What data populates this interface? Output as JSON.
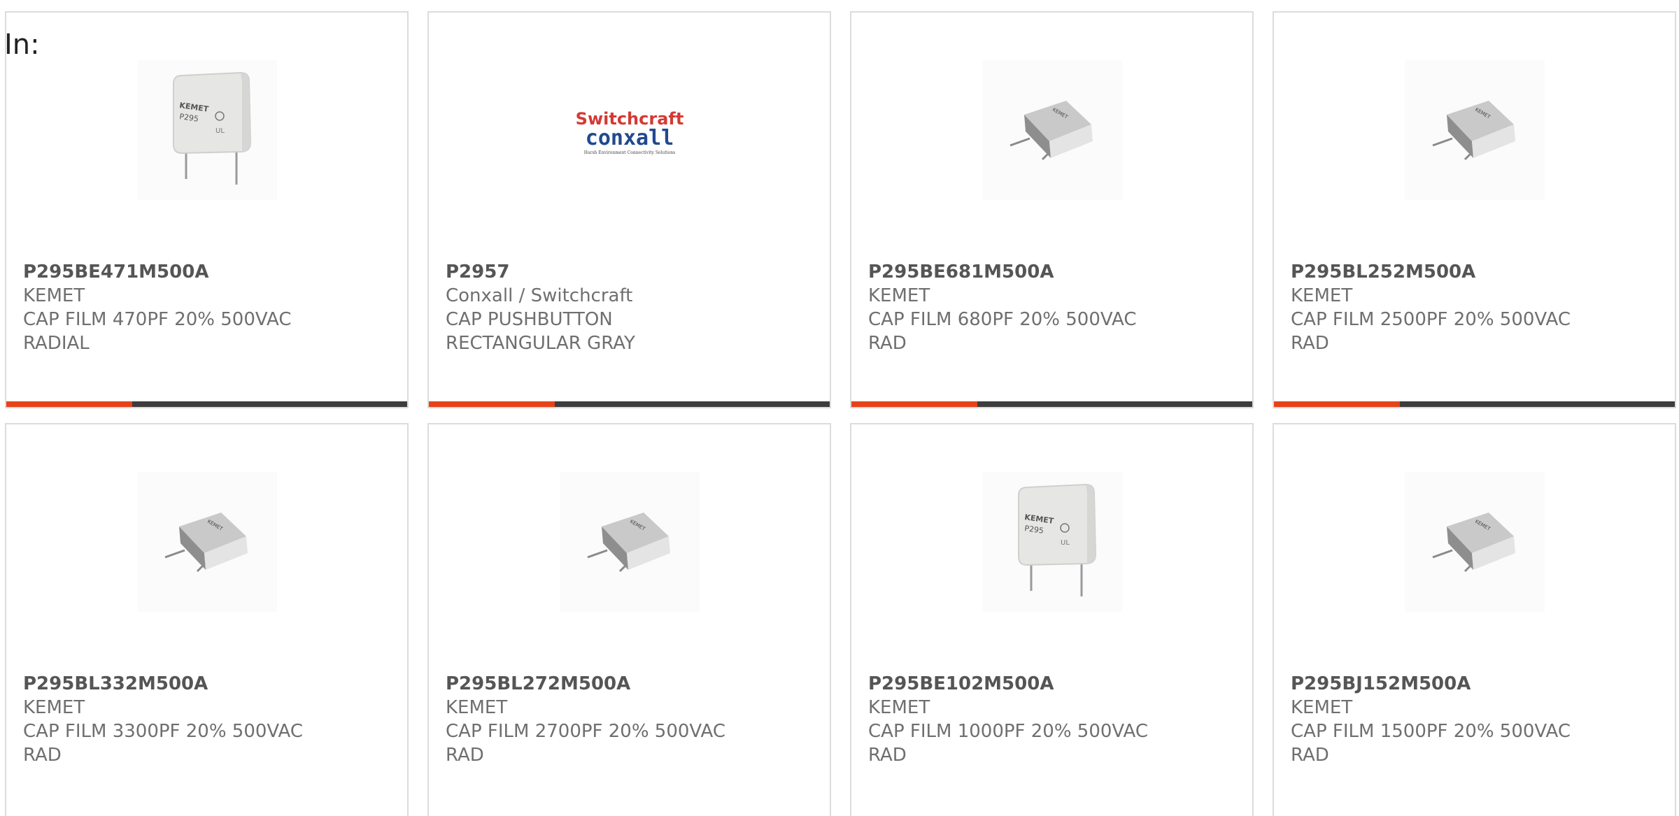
{
  "prefix_label": "In:",
  "colors": {
    "accent": "#e7421b",
    "bar_track": "#3d3d3d",
    "border": "#dcdcdc",
    "text": "#6f6f6f"
  },
  "products": [
    {
      "part_number": "P295BE471M500A",
      "manufacturer": "KEMET",
      "description_line1": "CAP FILM 470PF 20% 500VAC",
      "description_line2": "RADIAL",
      "image": "capacitor-front-image",
      "progress_fraction": 0.315
    },
    {
      "part_number": "P2957",
      "manufacturer": "Conxall / Switchcraft",
      "description_line1": "CAP PUSHBUTTON",
      "description_line2": "RECTANGULAR GRAY",
      "image": "switchcraft-conxall-logo",
      "logo_line1": "Switchcraft",
      "logo_line2": "conxall",
      "logo_tagline": "Harsh Environment Connectivity Solutions",
      "progress_fraction": 0.315
    },
    {
      "part_number": "P295BE681M500A",
      "manufacturer": "KEMET",
      "description_line1": "CAP FILM 680PF 20% 500VAC",
      "description_line2": "RAD",
      "image": "capacitor-angled-image",
      "progress_fraction": 0.315
    },
    {
      "part_number": "P295BL252M500A",
      "manufacturer": "KEMET",
      "description_line1": "CAP FILM 2500PF 20% 500VAC",
      "description_line2": "RAD",
      "image": "capacitor-angled-image",
      "progress_fraction": 0.315
    },
    {
      "part_number": "P295BL332M500A",
      "manufacturer": "KEMET",
      "description_line1": "CAP FILM 3300PF 20% 500VAC",
      "description_line2": "RAD",
      "image": "capacitor-angled-image"
    },
    {
      "part_number": "P295BL272M500A",
      "manufacturer": "KEMET",
      "description_line1": "CAP FILM 2700PF 20% 500VAC",
      "description_line2": "RAD",
      "image": "capacitor-angled-image"
    },
    {
      "part_number": "P295BE102M500A",
      "manufacturer": "KEMET",
      "description_line1": "CAP FILM 1000PF 20% 500VAC",
      "description_line2": "RAD",
      "image": "capacitor-front-image"
    },
    {
      "part_number": "P295BJ152M500A",
      "manufacturer": "KEMET",
      "description_line1": "CAP FILM 1500PF 20% 500VAC",
      "description_line2": "RAD",
      "image": "capacitor-angled-image"
    }
  ]
}
